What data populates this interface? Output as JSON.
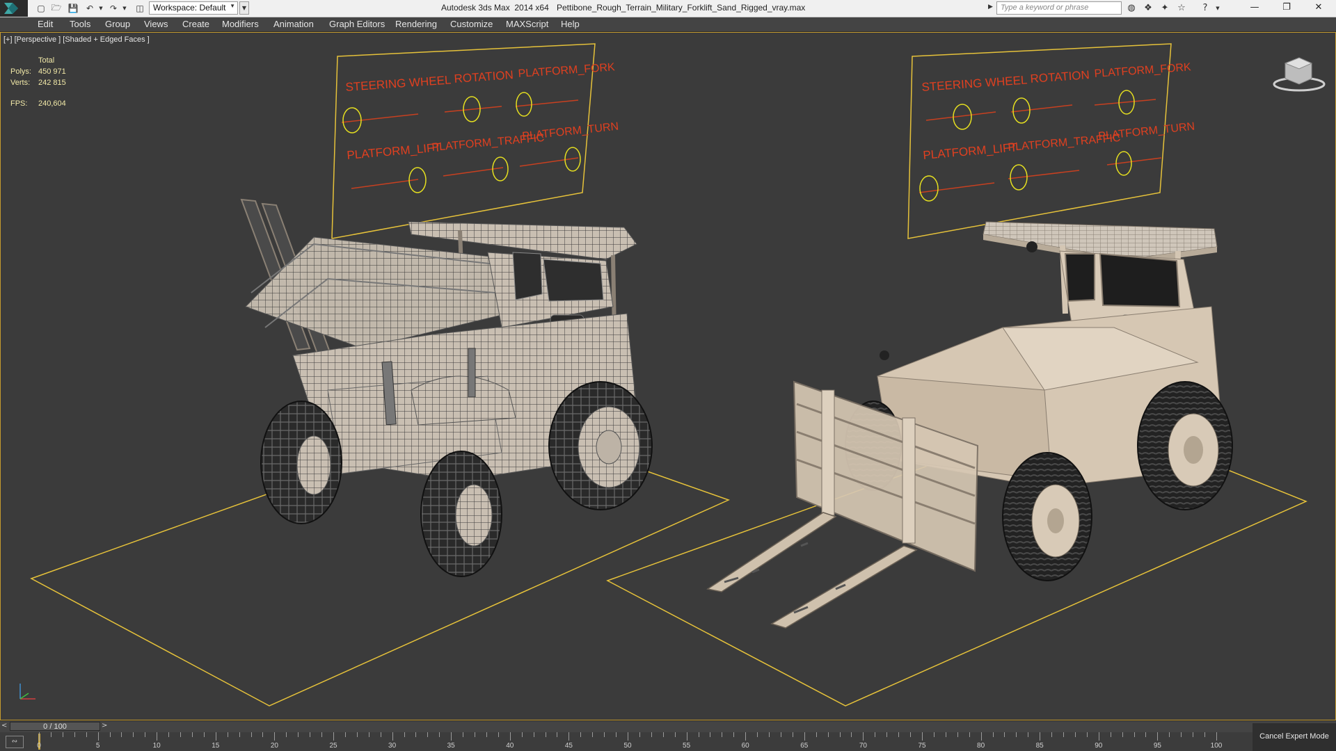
{
  "titlebar": {
    "workspace_label": "Workspace: Default",
    "app_title": "Autodesk 3ds Max  2014 x64",
    "file_name": "Pettibone_Rough_Terrain_Military_Forklift_Sand_Rigged_vray.max",
    "search_placeholder": "Type a keyword or phrase",
    "window_controls": [
      "minimize",
      "restore",
      "close"
    ]
  },
  "menu": {
    "items": [
      "Edit",
      "Tools",
      "Group",
      "Views",
      "Create",
      "Modifiers",
      "Animation",
      "Graph Editors",
      "Rendering",
      "Customize",
      "MAXScript",
      "Help"
    ]
  },
  "viewport": {
    "label": "[+] [Perspective ] [Shaded + Edged Faces ]",
    "stats": {
      "header": "Total",
      "polys_label": "Polys:",
      "polys": "450 971",
      "verts_label": "Verts:",
      "verts": "242 815",
      "fps_label": "FPS:",
      "fps": "240,604"
    },
    "rig_panel_labels": [
      "STEERING WHEEL",
      "ROTATION",
      "PLATFORM_FORK",
      "PLATFORM_LIFT",
      "PLATFORM_TRAFFIC",
      "PLATFORM_TURN"
    ],
    "colors": {
      "viewport_bg": "#3b3b3b",
      "selection_yellow": "#e6c23a",
      "rig_label_red": "#e04020",
      "body_sand": "#d8c8b4",
      "tire": "#2a2a2a"
    }
  },
  "timeline": {
    "slider_text": "0 / 100",
    "ticks": [
      "0",
      "5",
      "10",
      "15",
      "20",
      "25",
      "30",
      "35",
      "40",
      "45",
      "50",
      "55",
      "60",
      "65",
      "70",
      "75",
      "80",
      "85",
      "90",
      "95",
      "100"
    ]
  },
  "status": {
    "cancel_expert_label": "Cancel Expert Mode"
  }
}
